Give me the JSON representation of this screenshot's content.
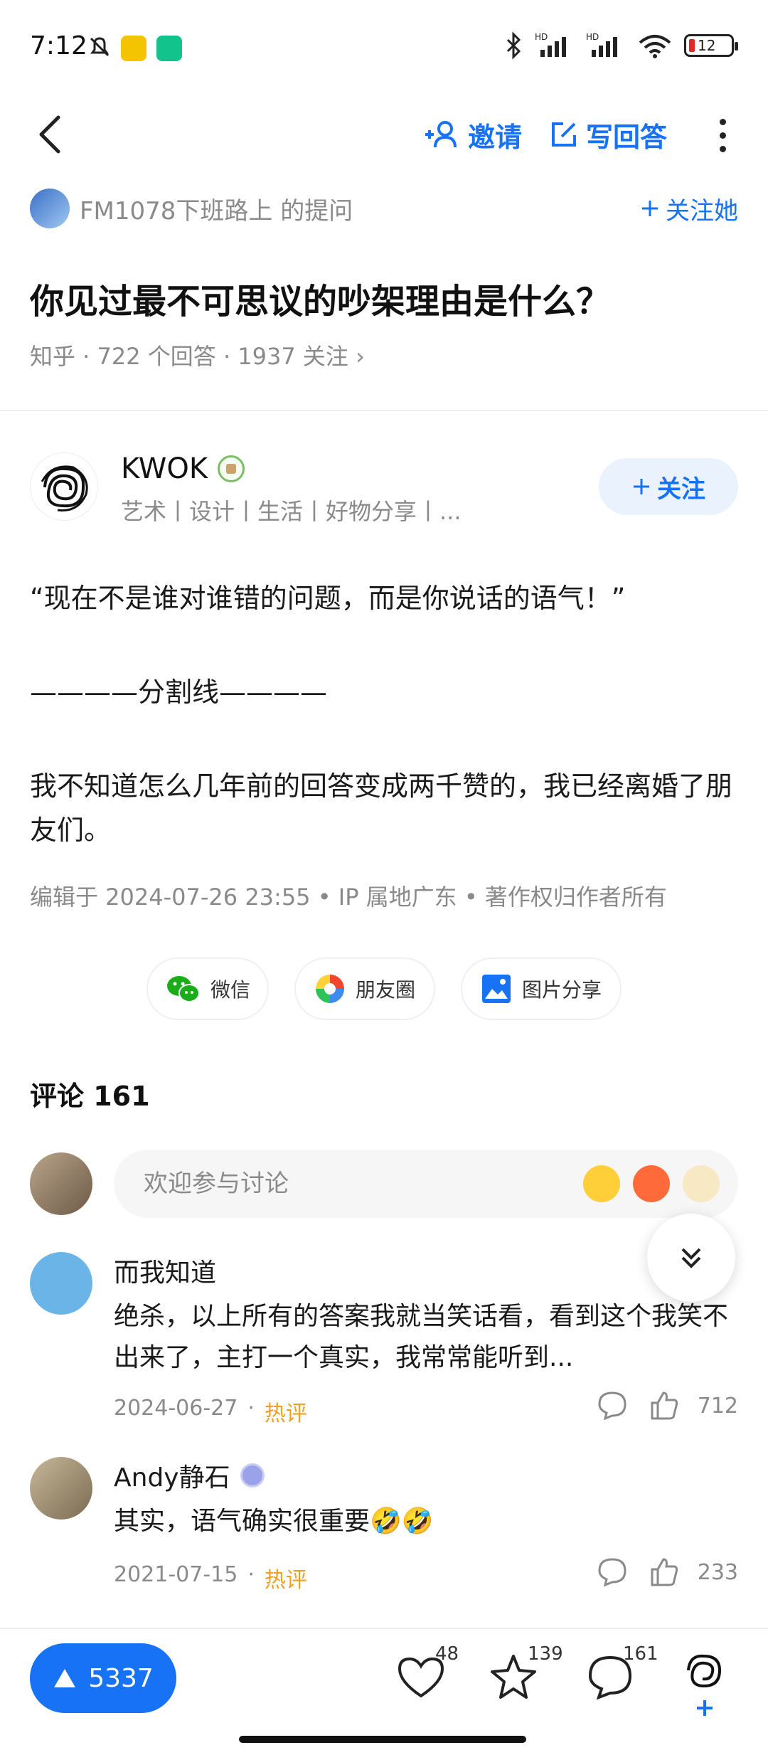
{
  "status_bar": {
    "time": "7:12",
    "battery": "12",
    "icons": [
      "bell-off-icon",
      "app-notification-icon",
      "shield-icon",
      "bluetooth-icon",
      "signal-hd-icon",
      "signal-hd-icon",
      "wifi-icon",
      "battery-icon"
    ]
  },
  "nav": {
    "invite_label": "邀请",
    "write_label": "写回答",
    "icons": [
      "back-arrow-icon",
      "add-person-icon",
      "edit-icon",
      "more-vertical-icon"
    ]
  },
  "question": {
    "asker": "FM1078下班路上 的提问",
    "follow_label": "关注她",
    "title": "你见过最不可思议的吵架理由是什么？",
    "meta": "知乎 · 722 个回答 · 1937 关注 ›"
  },
  "author": {
    "name": "KWOK",
    "tags": "艺术丨设计丨生活丨好物分享丨...",
    "follow_label": "关注"
  },
  "answer": {
    "p1": "“现在不是谁对谁错的问题，而是你说话的语气！”",
    "p2": "————分割线————",
    "p3": "我不知道怎么几年前的回答变成两千赞的，我已经离婚了朋友们。",
    "edited": "编辑于 2024-07-26 23:55 • IP 属地广东 • 著作权归作者所有"
  },
  "share": {
    "wechat": "微信",
    "moments": "朋友圈",
    "image": "图片分享"
  },
  "comments": {
    "title": "评论 161",
    "placeholder": "欢迎参与讨论",
    "items": [
      {
        "name": "而我知道",
        "text": "绝杀，以上所有的答案我就当笑话看，看到这个我笑不出来了，主打一个真实，我常常能听到...",
        "date": "2024-06-27",
        "tag": "热评",
        "likes": "712"
      },
      {
        "name": "Andy静石",
        "text": "其实，语气确实很重要🤣🤣",
        "date": "2021-07-15",
        "tag": "热评",
        "likes": "233"
      }
    ]
  },
  "bottom": {
    "votes": "5337",
    "likes": "48",
    "stars": "139",
    "comments": "161"
  },
  "colors": {
    "accent": "#1772f6",
    "hot": "#f0a020",
    "muted": "#8a8a8a"
  }
}
